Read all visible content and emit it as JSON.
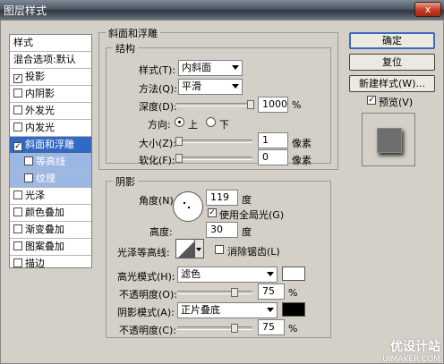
{
  "window": {
    "title": "图层样式",
    "close_label": "x"
  },
  "left_list": {
    "header": "样式",
    "blend_default": "混合选项:默认",
    "items": [
      {
        "label": "投影",
        "checked": true
      },
      {
        "label": "内阴影",
        "checked": false
      },
      {
        "label": "外发光",
        "checked": false
      },
      {
        "label": "内发光",
        "checked": false
      },
      {
        "label": "斜面和浮雕",
        "checked": true,
        "selected": true
      },
      {
        "label": "等高线",
        "checked": false,
        "sub": true
      },
      {
        "label": "纹理",
        "checked": false,
        "sub": true
      },
      {
        "label": "光泽",
        "checked": false
      },
      {
        "label": "颜色叠加",
        "checked": false
      },
      {
        "label": "渐变叠加",
        "checked": false
      },
      {
        "label": "图案叠加",
        "checked": false
      },
      {
        "label": "描边",
        "checked": false
      }
    ]
  },
  "bevel": {
    "group_title": "斜面和浮雕",
    "structure_title": "结构",
    "style_label": "样式(T):",
    "style_value": "内斜面",
    "method_label": "方法(Q):",
    "method_value": "平滑",
    "depth_label": "深度(D):",
    "depth_value": "1000",
    "depth_unit": "%",
    "direction_label": "方向:",
    "dir_up": "上",
    "dir_down": "下",
    "size_label": "大小(Z):",
    "size_value": "1",
    "size_unit": "像素",
    "soften_label": "软化(F):",
    "soften_value": "0",
    "soften_unit": "像素"
  },
  "shading": {
    "title": "阴影",
    "angle_label": "角度(N):",
    "angle_value": "119",
    "angle_unit": "度",
    "global_light": "使用全局光(G)",
    "altitude_label": "高度:",
    "altitude_value": "30",
    "altitude_unit": "度",
    "gloss_label": "光泽等高线:",
    "antialias": "消除锯齿(L)",
    "highlight_label": "高光模式(H):",
    "highlight_value": "滤色",
    "highlight_color": "#ffffff",
    "opacity1_label": "不透明度(O):",
    "opacity1_value": "75",
    "opacity1_unit": "%",
    "shadow_label": "阴影模式(A):",
    "shadow_value": "正片叠底",
    "shadow_color": "#000000",
    "opacity2_label": "不透明度(C):",
    "opacity2_value": "75",
    "opacity2_unit": "%"
  },
  "buttons": {
    "ok": "确定",
    "reset": "复位",
    "new_style": "新建样式(W)...",
    "preview": "预览(V)"
  },
  "watermark": {
    "main": "优设计站",
    "sub": "UIMAKER.COM"
  }
}
